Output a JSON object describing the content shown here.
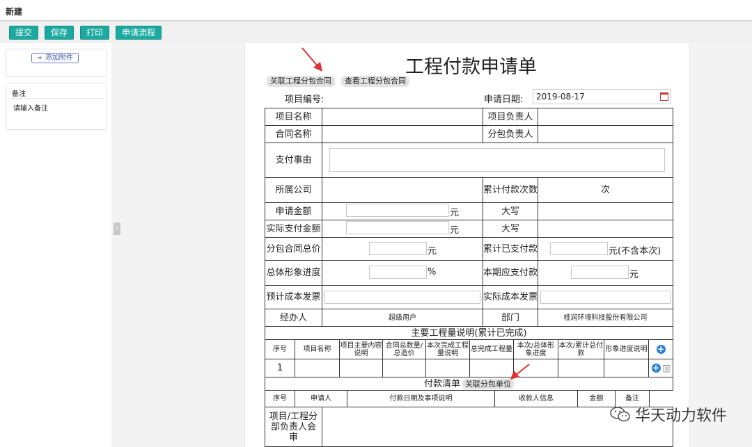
{
  "header": {
    "title": "新建"
  },
  "toolbar": {
    "submit": "提交",
    "save": "保存",
    "print": "打印",
    "flow": "申请流程"
  },
  "left": {
    "add_attachment": "+ 添加附件",
    "remark_label": "备注",
    "remark_placeholder": "请输入备注"
  },
  "doc": {
    "title": "工程付款申请单",
    "link_contract": "关联工程分包合同",
    "view_contract": "查看工程分包合同",
    "project_no_label": "项目编号:",
    "apply_date_label": "申请日期:",
    "apply_date": "2019-08-17",
    "labels": {
      "project_name": "项目名称",
      "project_leader": "项目负责人",
      "contract_name": "合同名称",
      "sub_leader": "分包负责人",
      "reason": "支付事由",
      "company": "所属公司",
      "paid_count": "累计付款次数",
      "count_unit": "次",
      "apply_amount": "申请金额",
      "capital1": "大写",
      "actual_amount": "实际支付金额",
      "capital2": "大写",
      "sub_total": "分包合同总价",
      "paid_total": "累计已支付款",
      "progress": "总体形象进度",
      "due_amount": "本期应支付款",
      "est_invoice": "预计成本发票",
      "actual_invoice": "实际成本发票",
      "handler": "经办人",
      "handler_value": "超级用户",
      "dept": "部门",
      "dept_value": "桂润环境科技股份有限公司",
      "yuan": "元",
      "percent": "%",
      "yuan_excl": "元(不含本次)"
    },
    "work_section": {
      "title": "主要工程量说明(累计已完成)",
      "headers": [
        "序号",
        "项目名称",
        "项目主要内容说明",
        "合同总数量/总造价",
        "本次完成工程量说明",
        "总完成工程量",
        "本次/总体形象进度",
        "本次/累计总付款",
        "形象进度说明"
      ],
      "row_no": "1"
    },
    "payment_section": {
      "title": "付款清单",
      "link_unit": "关联分包单位",
      "headers": [
        "序号",
        "申请人",
        "付款日期及事项说明",
        "收款人信息",
        "金额",
        "备注"
      ]
    },
    "review_label": "项目/工程分部负责人会审"
  },
  "watermark": "华天动力软件",
  "colors": {
    "button": "#1ba9a0",
    "accent_blue": "#2a7fd4",
    "arrow": "#e03030"
  }
}
